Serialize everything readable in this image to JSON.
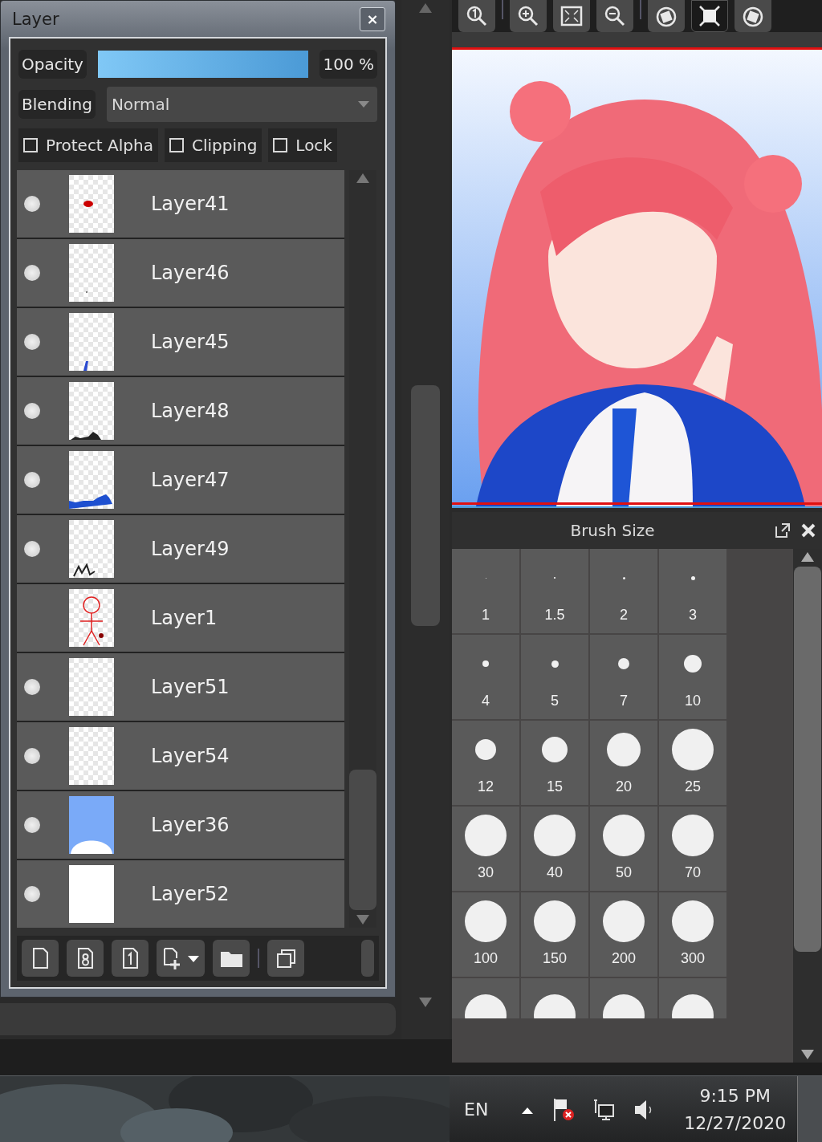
{
  "layer_panel": {
    "title": "Layer",
    "close": "×",
    "opacity": {
      "label": "Opacity",
      "level": 1,
      "reading": "100 %"
    },
    "blending": {
      "label": "Blending",
      "value": "Normal"
    },
    "options": [
      {
        "label": "Protect Alpha",
        "checked": false
      },
      {
        "label": "Clipping",
        "checked": false
      },
      {
        "label": "Lock",
        "checked": false
      }
    ],
    "layers": [
      {
        "name": "Layer41",
        "visible": true,
        "kind": "transparent"
      },
      {
        "name": "Layer46",
        "visible": true,
        "kind": "transparent"
      },
      {
        "name": "Layer45",
        "visible": true,
        "kind": "transparent"
      },
      {
        "name": "Layer48",
        "visible": true,
        "kind": "transparent"
      },
      {
        "name": "Layer47",
        "visible": true,
        "kind": "transparent"
      },
      {
        "name": "Layer49",
        "visible": true,
        "kind": "transparent"
      },
      {
        "name": "Layer1",
        "visible": false,
        "kind": "transparent"
      },
      {
        "name": "Layer51",
        "visible": true,
        "kind": "transparent"
      },
      {
        "name": "Layer54",
        "visible": true,
        "kind": "transparent"
      },
      {
        "name": "Layer36",
        "visible": true,
        "kind": "sky"
      },
      {
        "name": "Layer52",
        "visible": true,
        "kind": "white"
      }
    ]
  },
  "view_toolbar": [
    {
      "selected": false
    },
    {
      "selected": false
    },
    {
      "selected": false
    },
    {
      "selected": false
    },
    {
      "selected": false
    },
    {
      "selected": true
    },
    {
      "selected": false
    }
  ],
  "brush_size_panel": {
    "title": "Brush Size",
    "sizes": [
      {
        "label": "1",
        "kind": "full"
      },
      {
        "label": "1.5",
        "kind": "full"
      },
      {
        "label": "2",
        "kind": "full"
      },
      {
        "label": "3",
        "kind": "full"
      },
      {
        "label": "4",
        "kind": "full"
      },
      {
        "label": "5",
        "kind": "full"
      },
      {
        "label": "7",
        "kind": "full"
      },
      {
        "label": "10",
        "kind": "full"
      },
      {
        "label": "12",
        "kind": "full"
      },
      {
        "label": "15",
        "kind": "full"
      },
      {
        "label": "20",
        "kind": "full"
      },
      {
        "label": "25",
        "kind": "full"
      },
      {
        "label": "30",
        "kind": "full"
      },
      {
        "label": "40",
        "kind": "full"
      },
      {
        "label": "50",
        "kind": "full"
      },
      {
        "label": "70",
        "kind": "full"
      },
      {
        "label": "100",
        "kind": "full"
      },
      {
        "label": "150",
        "kind": "full"
      },
      {
        "label": "200",
        "kind": "full"
      },
      {
        "label": "300",
        "kind": "full"
      },
      {
        "kind": "cut"
      },
      {
        "kind": "cut"
      },
      {
        "kind": "cut"
      },
      {
        "kind": "cut"
      }
    ]
  },
  "taskbar": {
    "language": "EN",
    "time": "9:15 PM",
    "date": "12/27/2020"
  }
}
